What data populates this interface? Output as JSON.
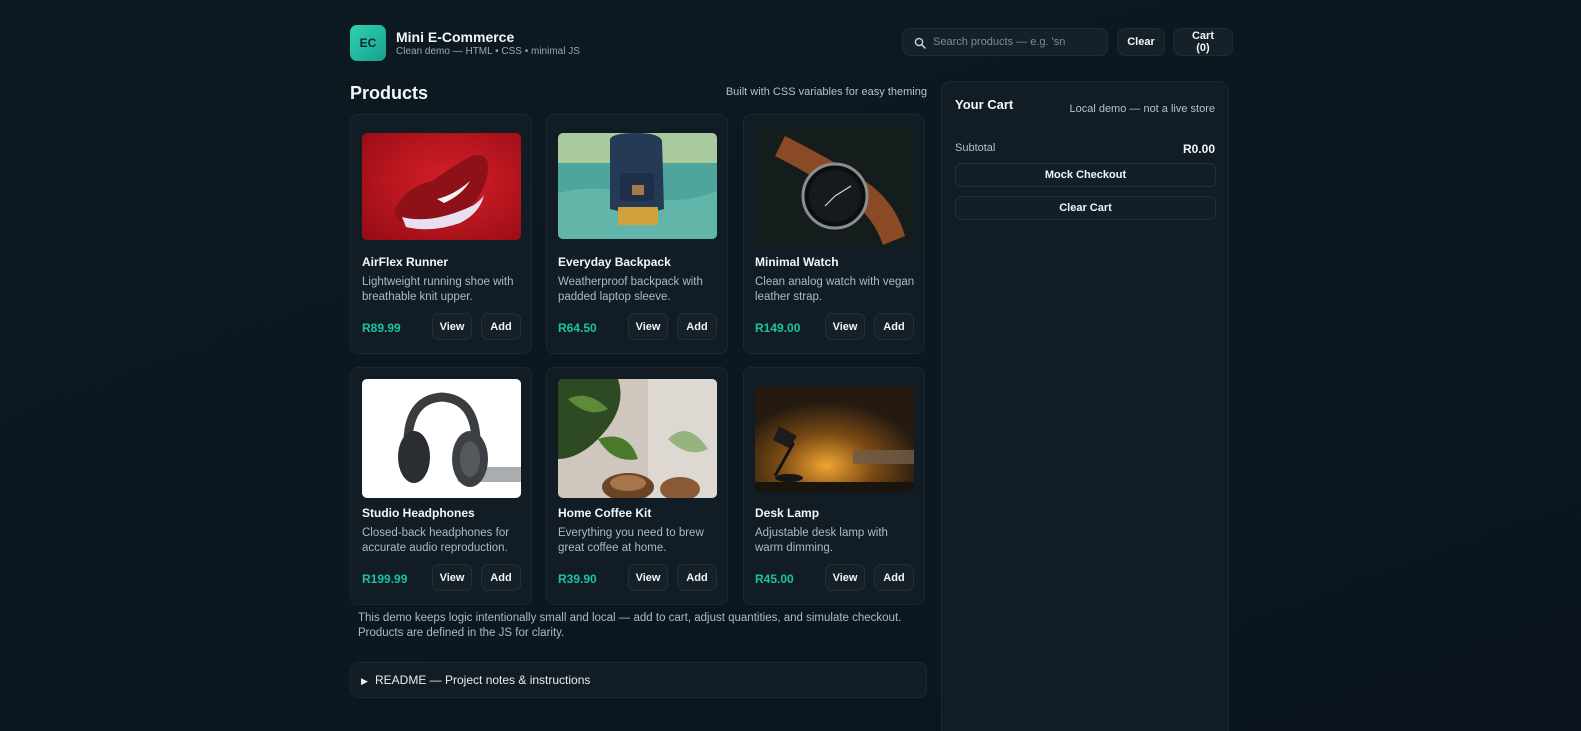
{
  "header": {
    "logo_text": "EC",
    "title": "Mini E-Commerce",
    "subtitle": "Clean demo — HTML • CSS • minimal JS",
    "search_placeholder": "Search products — e.g. 'sn",
    "search_icon": "search-icon",
    "clear_label": "Clear",
    "cart_label": "Cart (0)"
  },
  "main": {
    "title": "Products",
    "theming_note": "Built with CSS variables for easy theming",
    "products": [
      {
        "name": "AirFlex Runner",
        "description": "Lightweight running shoe with breathable knit upper.",
        "price": "R89.99",
        "view_label": "View",
        "add_label": "Add",
        "image": "red-running-shoe"
      },
      {
        "name": "Everyday Backpack",
        "description": "Weatherproof backpack with padded laptop sleeve.",
        "price": "R64.50",
        "view_label": "View",
        "add_label": "Add",
        "image": "backpack-in-water"
      },
      {
        "name": "Minimal Watch",
        "description": "Clean analog watch with vegan leather strap.",
        "price": "R149.00",
        "view_label": "View",
        "add_label": "Add",
        "image": "analog-watch"
      },
      {
        "name": "Studio Headphones",
        "description": "Closed-back headphones for accurate audio reproduction.",
        "price": "R199.99",
        "view_label": "View",
        "add_label": "Add",
        "image": "black-headphones"
      },
      {
        "name": "Home Coffee Kit",
        "description": "Everything you need to brew great coffee at home.",
        "price": "R39.90",
        "view_label": "View",
        "add_label": "Add",
        "image": "coffee-plant"
      },
      {
        "name": "Desk Lamp",
        "description": "Adjustable desk lamp with warm dimming.",
        "price": "R45.00",
        "view_label": "View",
        "add_label": "Add",
        "image": "desk-lamp"
      }
    ],
    "footnote": "This demo keeps logic intentionally small and local — add to cart, adjust quantities, and simulate checkout. Products are defined in the JS for clarity.",
    "readme_label": "README — Project notes & instructions"
  },
  "cart": {
    "title": "Your Cart",
    "note": "Local demo — not a live store",
    "subtotal_label": "Subtotal",
    "subtotal_value": "R0.00",
    "checkout_label": "Mock Checkout",
    "clear_cart_label": "Clear Cart"
  },
  "colors": {
    "accent": "#19c3a4",
    "background": "#0c1820",
    "card": "#111c25"
  }
}
